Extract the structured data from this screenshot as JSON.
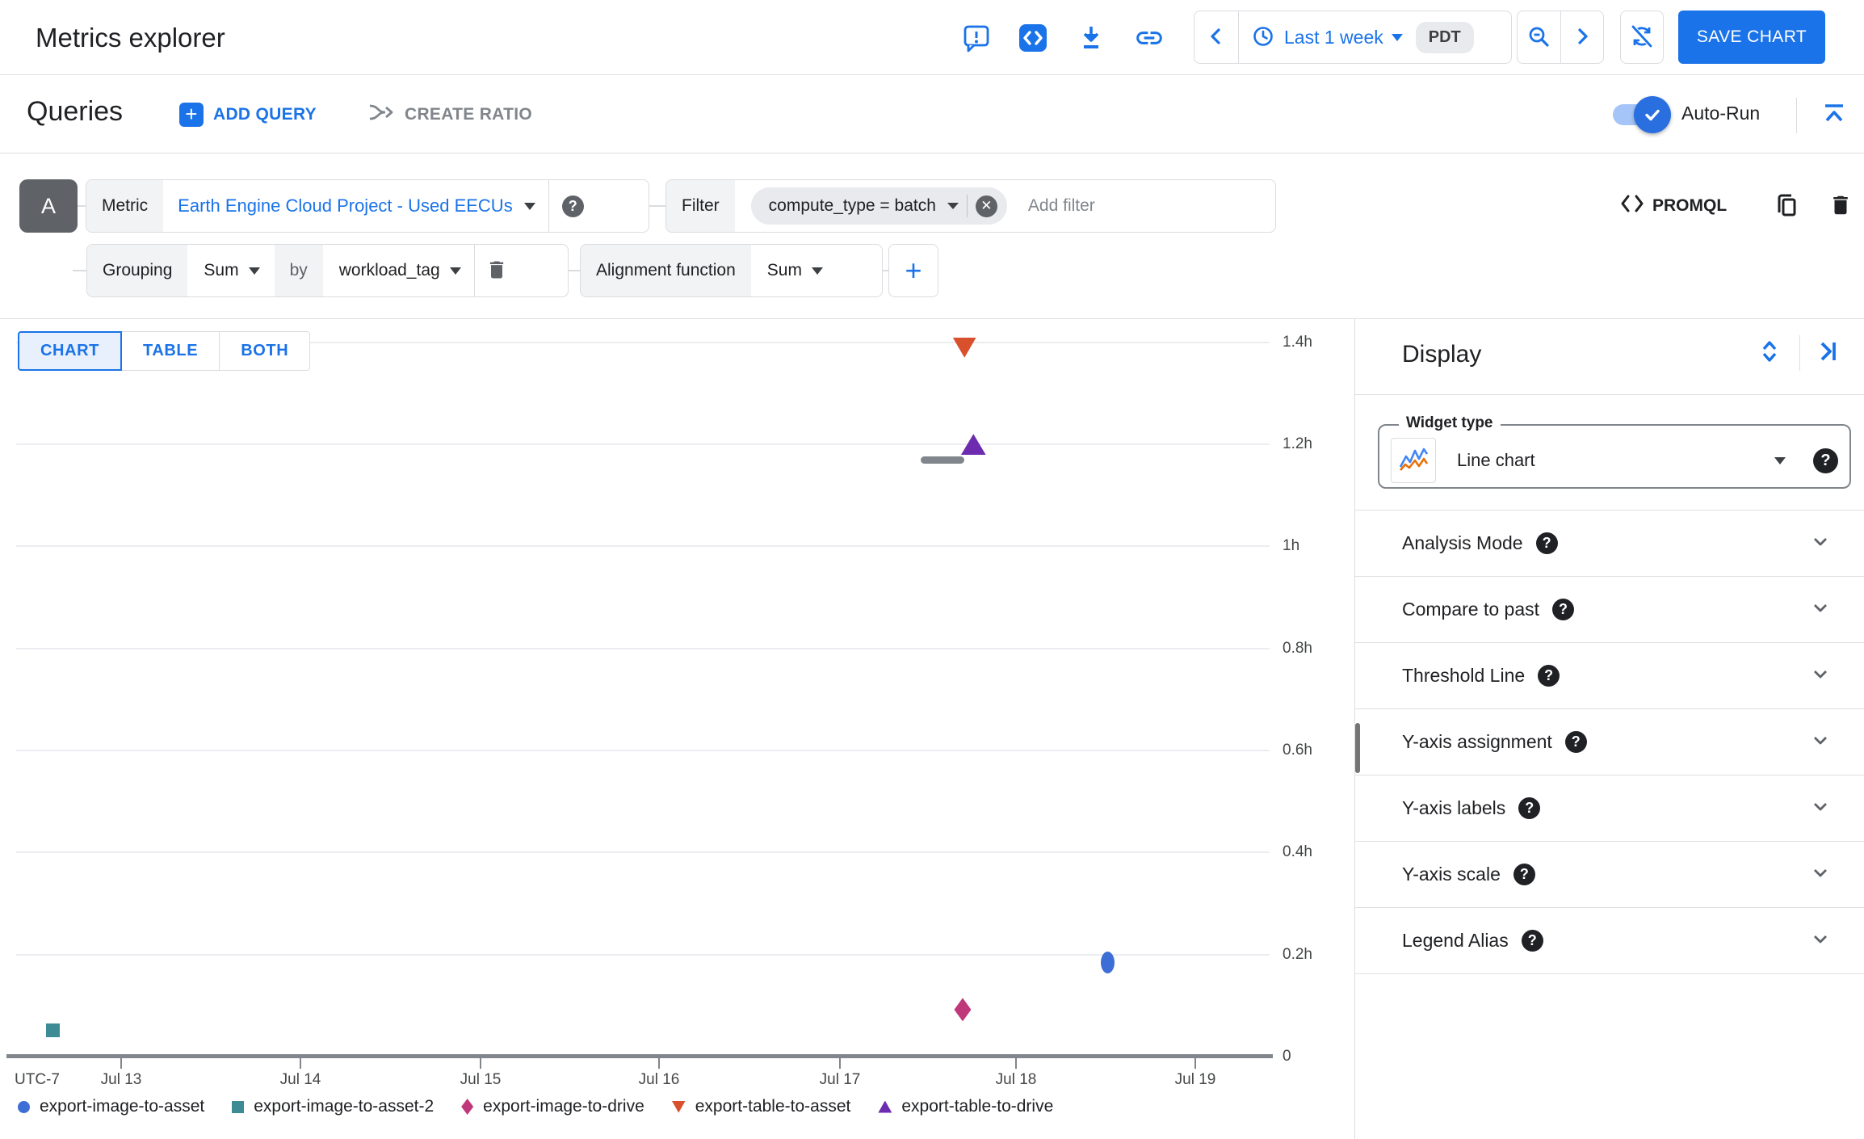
{
  "header": {
    "title": "Metrics explorer",
    "time_range": {
      "label": "Last 1 week",
      "timezone": "PDT"
    },
    "save_button": "SAVE CHART",
    "icons": {
      "feedback": "speech-bubble-exclamation",
      "code": "angle-brackets",
      "download": "arrow-down-bar",
      "link": "chain-link",
      "zoom_out": "magnifier-minus",
      "auto_refresh_off": "sync-disabled"
    }
  },
  "queries": {
    "title": "Queries",
    "add_query": "ADD QUERY",
    "create_ratio": "CREATE RATIO",
    "auto_run": "Auto-Run",
    "auto_run_enabled": true
  },
  "query_builder": {
    "query_letter": "A",
    "metric_label": "Metric",
    "metric_value": "Earth Engine Cloud Project - Used EECUs",
    "filter_label": "Filter",
    "filter_chip": "compute_type = batch",
    "add_filter_placeholder": "Add filter",
    "promql_label": "PROMQL",
    "grouping_label": "Grouping",
    "grouping_fn": "Sum",
    "by_label": "by",
    "group_by_value": "workload_tag",
    "alignment_label": "Alignment function",
    "alignment_fn": "Sum"
  },
  "view_tabs": [
    {
      "label": "CHART",
      "selected": true
    },
    {
      "label": "TABLE",
      "selected": false
    },
    {
      "label": "BOTH",
      "selected": false
    }
  ],
  "chart_data": {
    "type": "scatter",
    "title": "",
    "xlabel": "",
    "ylabel": "hours",
    "x_prefix": "UTC-7",
    "x_ticks": [
      "Jul 13",
      "Jul 14",
      "Jul 15",
      "Jul 16",
      "Jul 17",
      "Jul 18",
      "Jul 19"
    ],
    "y_ticks": [
      "1.4h",
      "1.2h",
      "1h",
      "0.8h",
      "0.6h",
      "0.4h",
      "0.2h",
      "0"
    ],
    "ylim": [
      0,
      1.5
    ],
    "xlim_days_of_july": [
      12.4,
      19.4
    ],
    "grid": "horizontal-only",
    "legend_position": "bottom",
    "series": [
      {
        "name": "export-image-to-asset",
        "marker": "circle",
        "color": "#3c6ed5",
        "points": [
          {
            "x_day_of_july": 18.51,
            "y_hours": 0.185
          }
        ]
      },
      {
        "name": "export-image-to-asset-2",
        "marker": "square",
        "color": "#3d8b94",
        "points": [
          {
            "x_day_of_july": 12.62,
            "y_hours": 0.051
          }
        ]
      },
      {
        "name": "export-image-to-drive",
        "marker": "diamond",
        "color": "#bf3879",
        "points": [
          {
            "x_day_of_july": 17.7,
            "y_hours": 0.092
          }
        ]
      },
      {
        "name": "export-table-to-asset",
        "marker": "triangle-down",
        "color": "#d8502c",
        "points": [
          {
            "x_day_of_july": 17.71,
            "y_hours": 1.39
          }
        ]
      },
      {
        "name": "export-table-to-drive",
        "marker": "triangle-up",
        "color": "#6d2cb0",
        "points": [
          {
            "x_day_of_july": 17.76,
            "y_hours": 1.2
          }
        ]
      }
    ]
  },
  "display_panel": {
    "title": "Display",
    "widget_type": {
      "label": "Widget type",
      "value": "Line chart"
    },
    "sections": [
      {
        "label": "Analysis Mode"
      },
      {
        "label": "Compare to past"
      },
      {
        "label": "Threshold Line"
      },
      {
        "label": "Y-axis assignment"
      },
      {
        "label": "Y-axis labels"
      },
      {
        "label": "Y-axis scale"
      },
      {
        "label": "Legend Alias"
      }
    ]
  },
  "colors": {
    "accent_blue": "#1a73e8",
    "selected_tab_bg": "#e8f0fe",
    "chip_gray": "#e8eaed",
    "axis_gray": "#80868b"
  }
}
